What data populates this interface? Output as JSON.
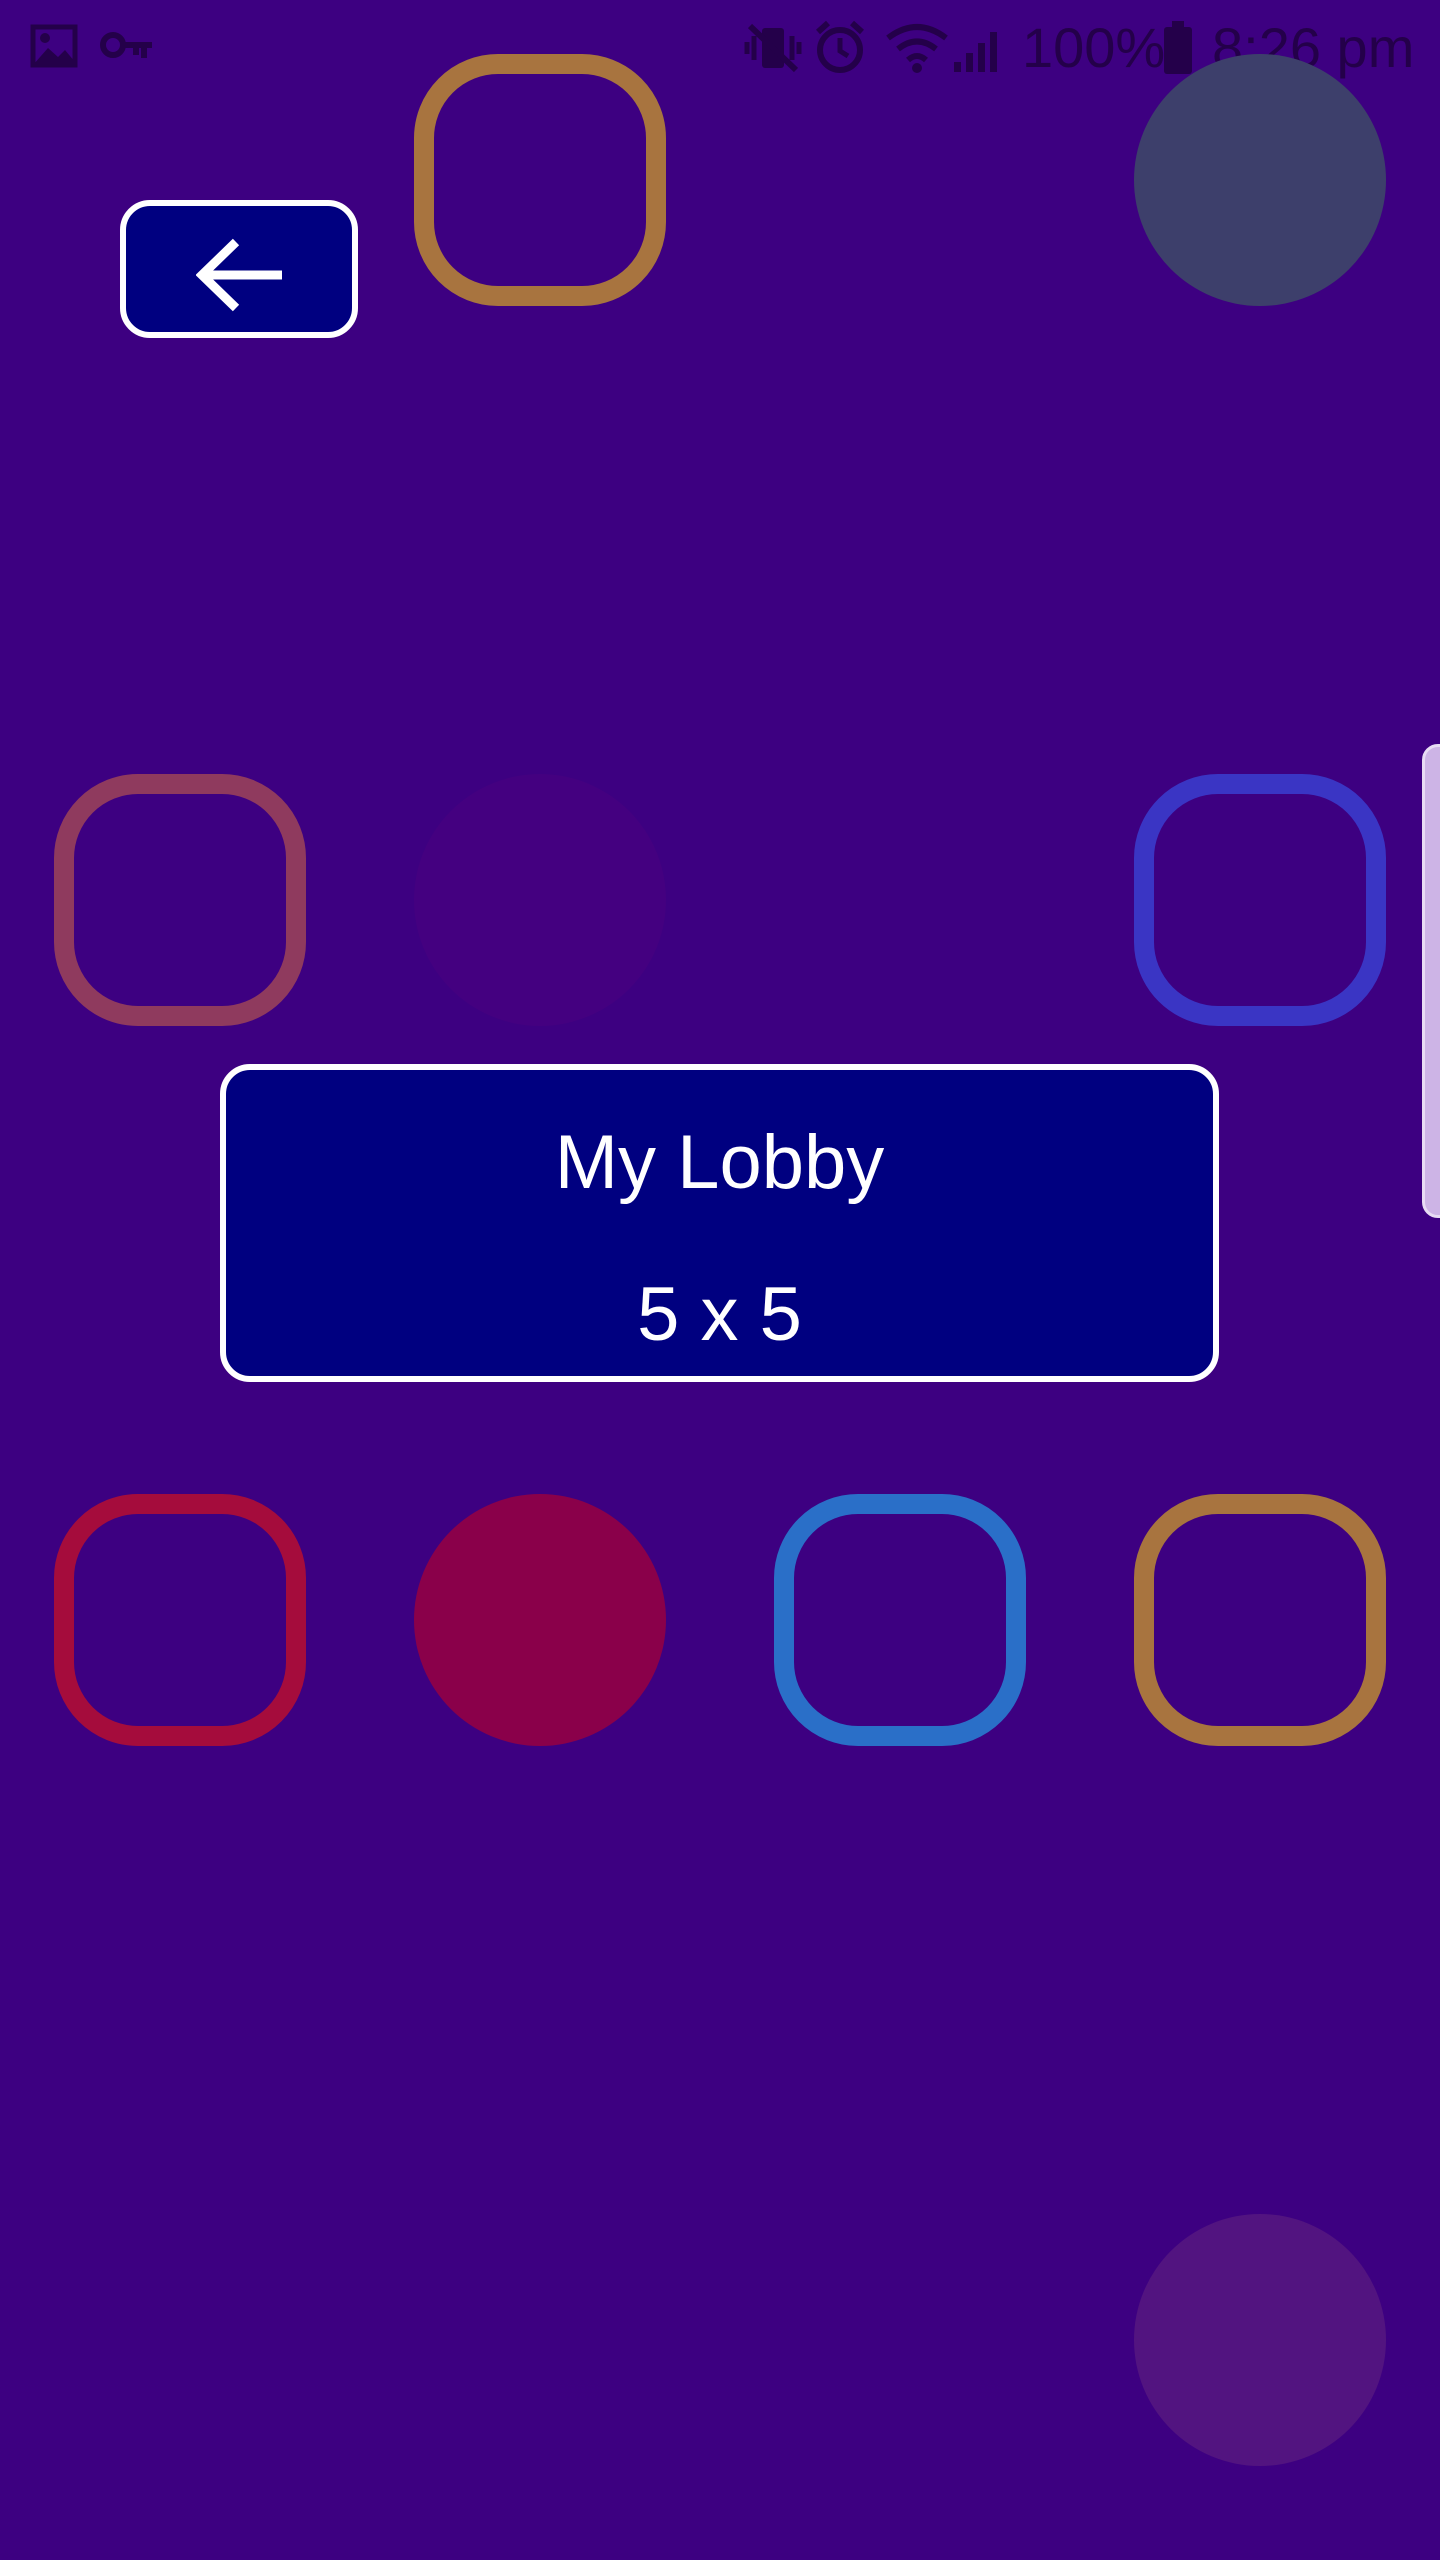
{
  "status_bar": {
    "battery_percent": "100%",
    "time": "8:26 pm",
    "icons": [
      "image-icon",
      "key-icon",
      "mute-vibrate-icon",
      "alarm-icon",
      "wifi-icon",
      "signal-icon",
      "battery-icon"
    ]
  },
  "back_button": {
    "icon": "arrow-left-icon"
  },
  "lobby": {
    "name": "My Lobby",
    "size": "5 x 5"
  },
  "colors": {
    "background": "#3d0081",
    "card": "#000080",
    "border": "#ffffff",
    "orange": "#a8743f",
    "slate": "#3d3f6b",
    "mauve": "#8f3a5e",
    "faint_purple": "#440080",
    "blue": "#3a35c4",
    "crimson": "#a50c3c",
    "magenta": "#8a004a",
    "sky": "#2a6fc8",
    "dim_violet": "#521480"
  }
}
